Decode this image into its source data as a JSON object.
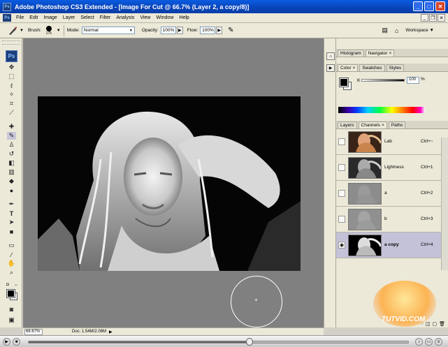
{
  "window": {
    "title": "Adobe Photoshop CS3 Extended - [Image For Cut @ 66.7% (Layer 2, a copy/8)]",
    "app_icon": "Ps",
    "minimize_glyph": "_",
    "maximize_glyph": "□",
    "close_glyph": "✕"
  },
  "menu": {
    "items": [
      "File",
      "Edit",
      "Image",
      "Layer",
      "Select",
      "Filter",
      "Analysis",
      "View",
      "Window",
      "Help"
    ],
    "app_icon": "Ps"
  },
  "options": {
    "brush_label": "Brush:",
    "brush_size": "175",
    "mode_label": "Mode:",
    "mode_value": "Normal",
    "opacity_label": "Opacity:",
    "opacity_value": "100%",
    "flow_label": "Flow:",
    "flow_value": "100%",
    "workspace_label": "Workspace ▼"
  },
  "tools": {
    "logo": "Ps",
    "icons": [
      "move-tool-icon",
      "marquee-tool-icon",
      "lasso-tool-icon",
      "magic-wand-tool-icon",
      "crop-tool-icon",
      "slice-tool-icon",
      "healing-brush-tool-icon",
      "brush-tool-icon",
      "clone-stamp-tool-icon",
      "history-brush-tool-icon",
      "eraser-tool-icon",
      "gradient-tool-icon",
      "blur-tool-icon",
      "dodge-tool-icon",
      "pen-tool-icon",
      "type-tool-icon",
      "path-selection-tool-icon",
      "shape-tool-icon",
      "notes-tool-icon",
      "eyedropper-tool-icon",
      "hand-tool-icon",
      "zoom-tool-icon"
    ]
  },
  "status": {
    "zoom": "66.67%",
    "doc": "Doc: 1.54M/2.06M"
  },
  "panels": {
    "top_tabs": [
      {
        "label": "Histogram"
      },
      {
        "label": "Navigator",
        "close": "×"
      }
    ],
    "color_tabs": [
      {
        "label": "Color",
        "close": "×"
      },
      {
        "label": "Swatches"
      },
      {
        "label": "Styles"
      }
    ],
    "color": {
      "k_label": "K",
      "k_value": "100",
      "k_unit": "%"
    },
    "layer_tabs": [
      {
        "label": "Layers"
      },
      {
        "label": "Channels",
        "close": "×"
      },
      {
        "label": "Paths"
      }
    ],
    "channels": [
      {
        "name": "Lab",
        "shortcut": "Ctrl+~",
        "visible": false,
        "selected": false
      },
      {
        "name": "Lightness",
        "shortcut": "Ctrl+1",
        "visible": false,
        "selected": false
      },
      {
        "name": "a",
        "shortcut": "Ctrl+2",
        "visible": false,
        "selected": false
      },
      {
        "name": "b",
        "shortcut": "Ctrl+3",
        "visible": false,
        "selected": false
      },
      {
        "name": "a copy",
        "shortcut": "Ctrl+4",
        "visible": true,
        "selected": true
      }
    ]
  },
  "watermark": "TUTVID.COM",
  "colors": {
    "titlebar": "#0a5ce0",
    "workspace": "#808080",
    "selected_channel": "#c4c2d8"
  }
}
